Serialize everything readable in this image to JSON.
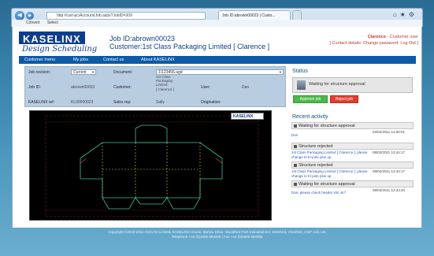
{
  "browser": {
    "address": "http://cart-pc/Account/Job.aspx?JobID=309",
    "active_tab": "Job ID:abrown00023 | Custo...",
    "toolbar_items": [
      "Convert",
      "Select"
    ]
  },
  "brand": {
    "logo_text": "KASELINX",
    "script_text": "Design Scheduling"
  },
  "header": {
    "job_id": "Job ID:abrown00023",
    "customer": "Customer:1st Class Packaging Limited [ Clarence ]",
    "user_name": "Clarence",
    "user_role": "- Customer user",
    "links": "[ Contact details: Change password: Log Out ]"
  },
  "menu": [
    "Customer menu",
    "My jobs",
    "Contact us",
    "About KASELINX"
  ],
  "job_panel": {
    "job_revision_label": "Job revision:",
    "job_revision_value": "Current",
    "document_label": "Document:",
    "document_value": "1\\123456.agd",
    "job_id_label": "Job ID:",
    "job_id_value": "abrown00023",
    "customer_label": "Customer:",
    "customer_value": [
      "1st Class",
      "Packaging",
      "Limited",
      "[ Clarence ]"
    ],
    "user_label": "User:",
    "user_value": "Dan",
    "kaselinx_ref_label": "KASELINX ref:",
    "kaselinx_ref_value": "KL00000023",
    "sales_rep_label": "Sales rep:",
    "sales_rep_value": "Sally",
    "origination_label": "Origination:"
  },
  "drawing_logo": "KASELINX",
  "status": {
    "heading": "Status",
    "text": "Waiting for structure approval",
    "approve_label": "Approve job",
    "reject_label": "Reject job"
  },
  "activity": {
    "heading": "Recent activity",
    "items": [
      {
        "title": "Waiting for structure approval",
        "body": "Dan",
        "date": "02/02/2011 12:00:01"
      },
      {
        "title": "Structure rejected",
        "body": "1st Class Packaging Limited [ Clarence ]: please change to tri-pole plus up",
        "date": "08/02/2011 13:44:17"
      },
      {
        "title": "Structure rejected",
        "body": "1st Class Packaging Limited [ Clarence ]: please change to tri-pole plus up",
        "date": "08/02/2011 13:44:17"
      },
      {
        "title": "Waiting for structure approval",
        "body": "Dan: please check header slot ok?",
        "date": "08/02/2011 13:43:40"
      }
    ]
  },
  "footer": {
    "line1": "Copyright ©2010-2011 AG/CAD Limited, KASELINX House, Barlow Drive, Woodford Park Industrial Est, Winsford, Cheshire, CW7 2JZ, UK",
    "line2": "Telephone +44 (0)1606 863340 | Fax +44 (0)1606 863355"
  },
  "colors": {
    "brand_blue": "#0d3e8c",
    "menu_blue": "#0d5aa7",
    "approve_green": "#4db84a",
    "reject_red": "#e43b2f",
    "accent_red": "#c0392b"
  }
}
